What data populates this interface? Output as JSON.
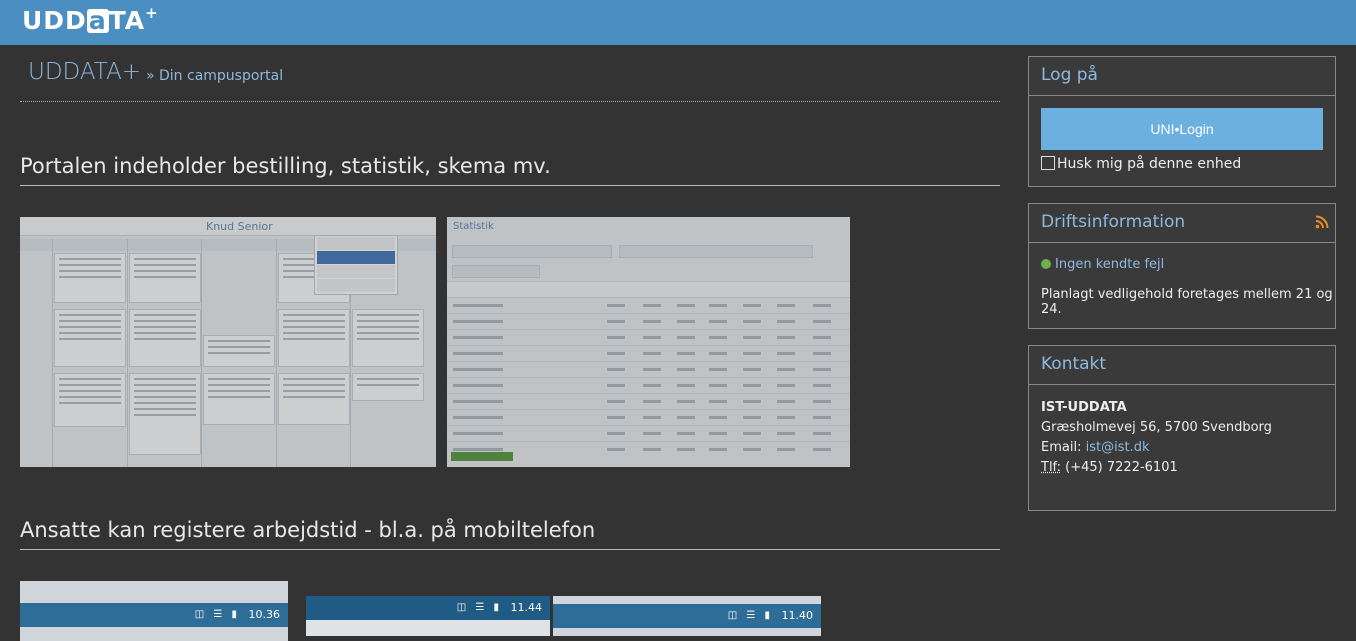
{
  "header": {
    "logo_text": "UDD",
    "logo_a": "a",
    "logo_rest": "TA",
    "logo_plus": "+"
  },
  "main": {
    "brand": "UDDATA+",
    "breadcrumb": "» Din campusportal",
    "section1_title": "Portalen indeholder bestilling, statistik, skema mv.",
    "section2_title": "Ansatte kan registere arbejdstid - bl.a. på mobiltelefon",
    "schedule_title": "Knud Senior",
    "stats_title": "Statistik",
    "phone_times": [
      "10.36",
      "11.44",
      "11.40"
    ]
  },
  "login": {
    "heading": "Log på",
    "button": "UNI•Login",
    "remember": "Husk mig på denne enhed"
  },
  "ops": {
    "heading": "Driftsinformation",
    "status": "Ingen kendte fejl",
    "maintenance": "Planlagt vedligehold foretages mellem 21 og 24."
  },
  "contact": {
    "heading": "Kontakt",
    "org": "IST-UDDATA",
    "address": "Græsholmevej 56, 5700 Svendborg",
    "email_label": "Email: ",
    "email": "ist@ist.dk",
    "phone_label": "Tlf:",
    "phone": " (+45) 7222-6101"
  },
  "colors": {
    "topbar": "#4a8ec2",
    "accent": "#8fb9de",
    "login": "#6cb0e0",
    "ok": "#6ab04c"
  }
}
